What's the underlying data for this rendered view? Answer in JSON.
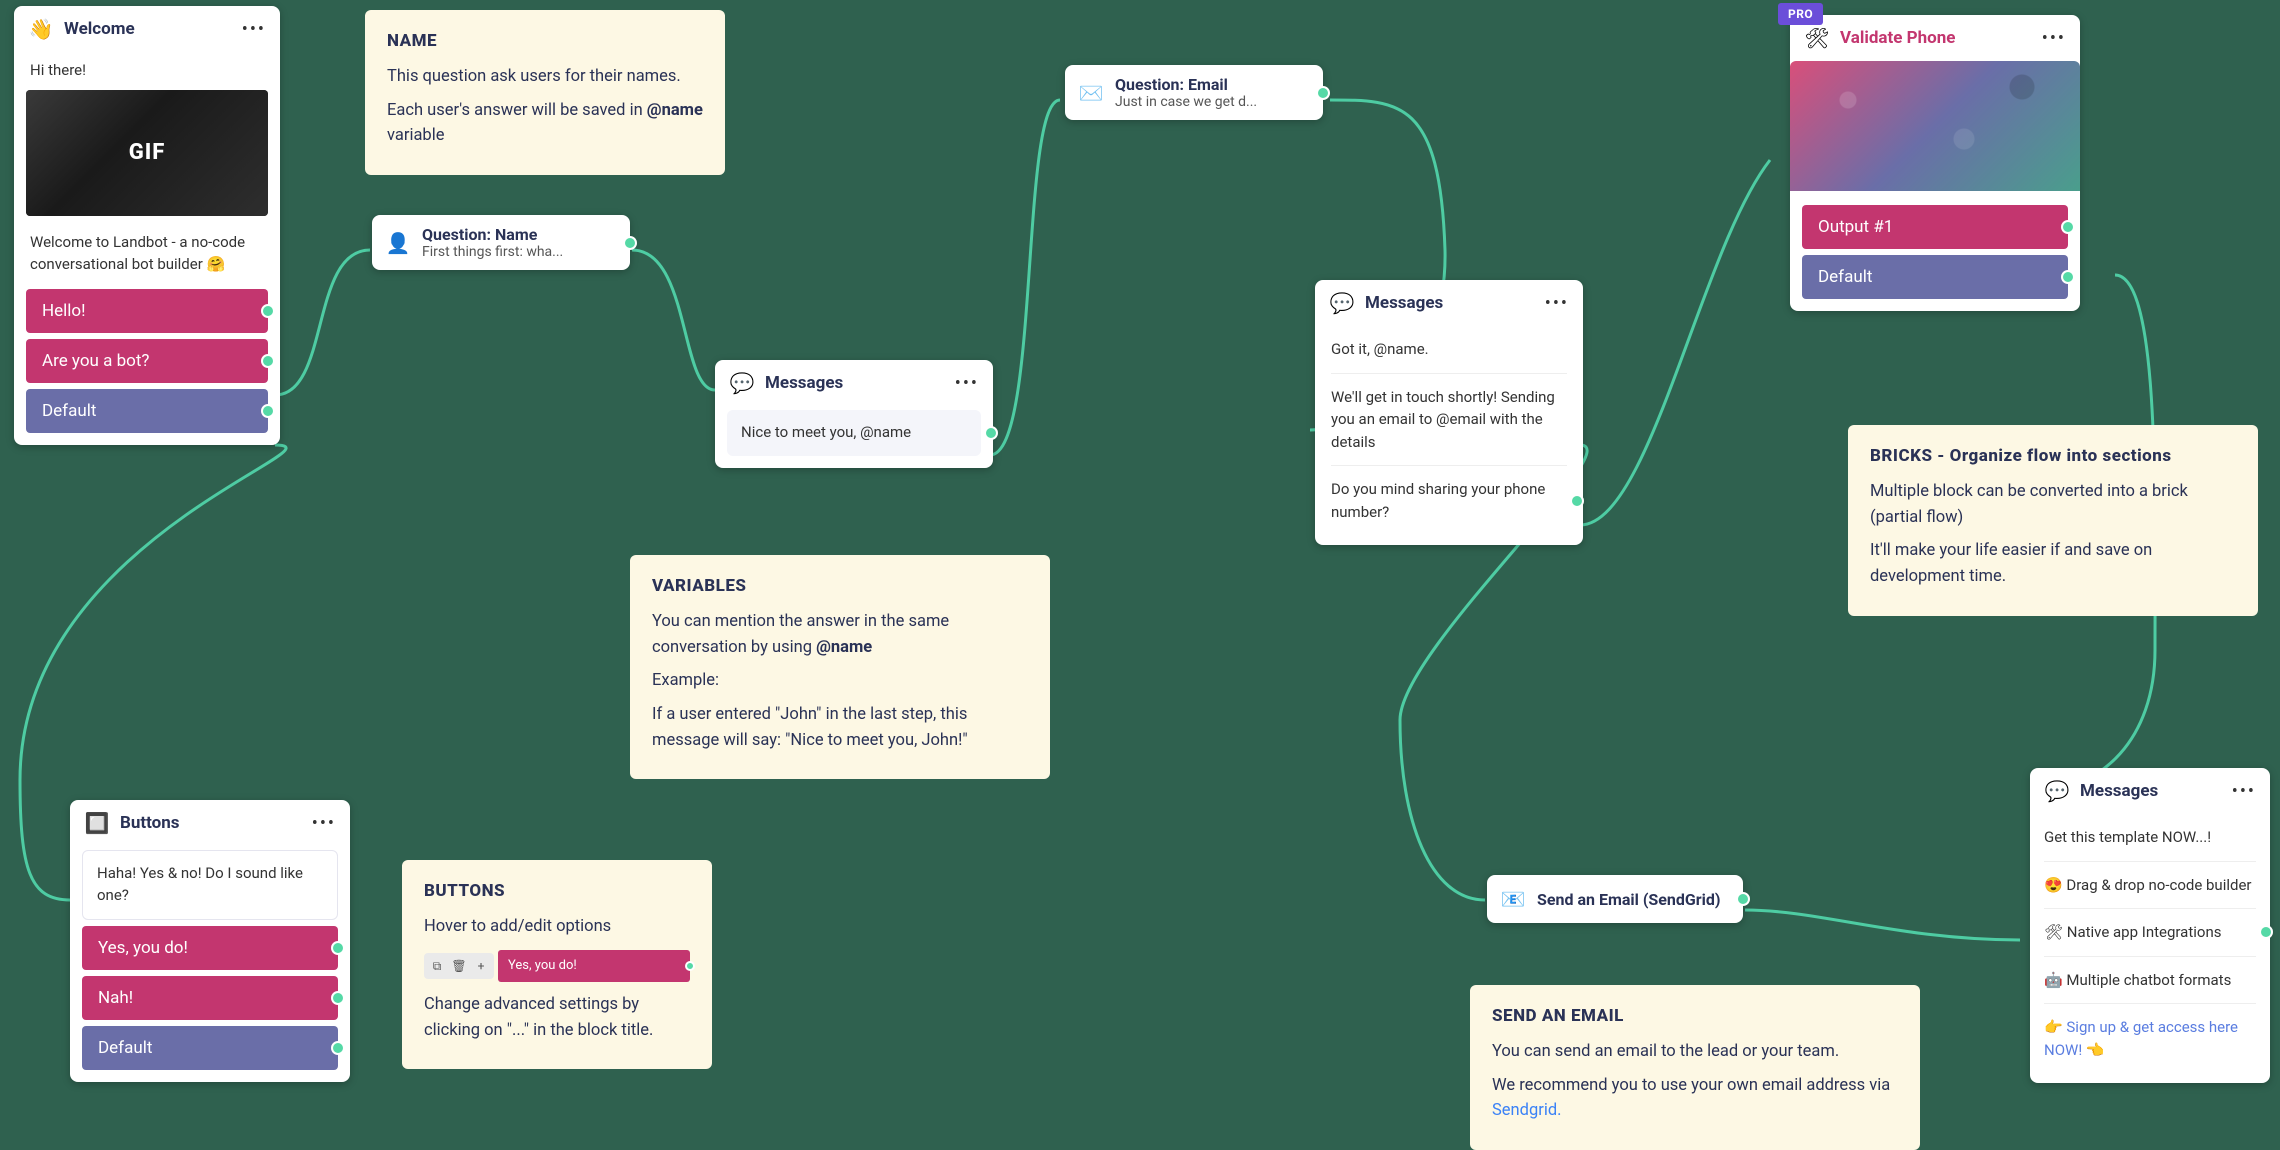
{
  "welcome": {
    "title": "Welcome",
    "icon": "👋",
    "hi": "Hi there!",
    "gif_label": "GIF",
    "intro": "Welcome to Landbot - a no-code conversational bot builder 🤗",
    "buttons": [
      "Hello!",
      "Are you a bot?",
      "Default"
    ]
  },
  "notes": {
    "name": {
      "title": "NAME",
      "p1": "This question ask users for their names.",
      "p2_a": "Each user's answer will be saved in ",
      "p2_b": "@name",
      "p2_c": " variable"
    },
    "variables": {
      "title": "VARIABLES",
      "p1_a": "You can mention the answer in the same conversation by using ",
      "p1_b": "@name",
      "p2": "Example:",
      "p3": "If a user entered \"John\" in the last step, this message will say: \"Nice to meet you, John!\""
    },
    "buttons": {
      "title": "BUTTONS",
      "p1": "Hover to add/edit options",
      "edit_label": "Yes, you do!",
      "p2": "Change advanced settings by clicking on \"...\" in the block title."
    },
    "bricks": {
      "title": "BRICKS - Organize flow into sections",
      "p1": "Multiple block can be converted into a brick (partial flow)",
      "p2": "It'll make your life easier if and save on development time."
    },
    "email": {
      "title": "SEND AN EMAIL",
      "p1": "You can send an email to the lead or your team.",
      "p2_a": "We recommend you to use your own email address via ",
      "p2_link": "Sendgrid."
    }
  },
  "question_name": {
    "icon": "👤",
    "title": "Question: Name",
    "sub": "First things first: wha..."
  },
  "question_email": {
    "icon": "✉️",
    "title": "Question: Email",
    "sub": "Just in case we get d..."
  },
  "messages1": {
    "icon": "💬",
    "title": "Messages",
    "msg": "Nice to meet you, @name"
  },
  "messages2": {
    "icon": "💬",
    "title": "Messages",
    "items": [
      "Got it, @name.",
      "We'll get in touch shortly! Sending you an email to @email with the details",
      "Do you mind sharing your phone number?"
    ]
  },
  "buttons_block": {
    "icon": "🔲",
    "title": "Buttons",
    "prompt": "Haha! Yes & no! Do I sound like one?",
    "options": [
      "Yes, you do!",
      "Nah!",
      "Default"
    ]
  },
  "validate": {
    "badge": "PRO",
    "title": "Validate Phone",
    "outputs": [
      "Output #1",
      "Default"
    ]
  },
  "send_email": {
    "icon": "📧",
    "title": "Send an Email (SendGrid)"
  },
  "messages3": {
    "icon": "💬",
    "title": "Messages",
    "items": [
      "Get this template NOW...!",
      "😍 Drag & drop no-code builder",
      "🛠 Native app Integrations",
      "🤖 Multiple chatbot formats"
    ],
    "link": "👉 Sign up & get access here NOW! 👈"
  }
}
